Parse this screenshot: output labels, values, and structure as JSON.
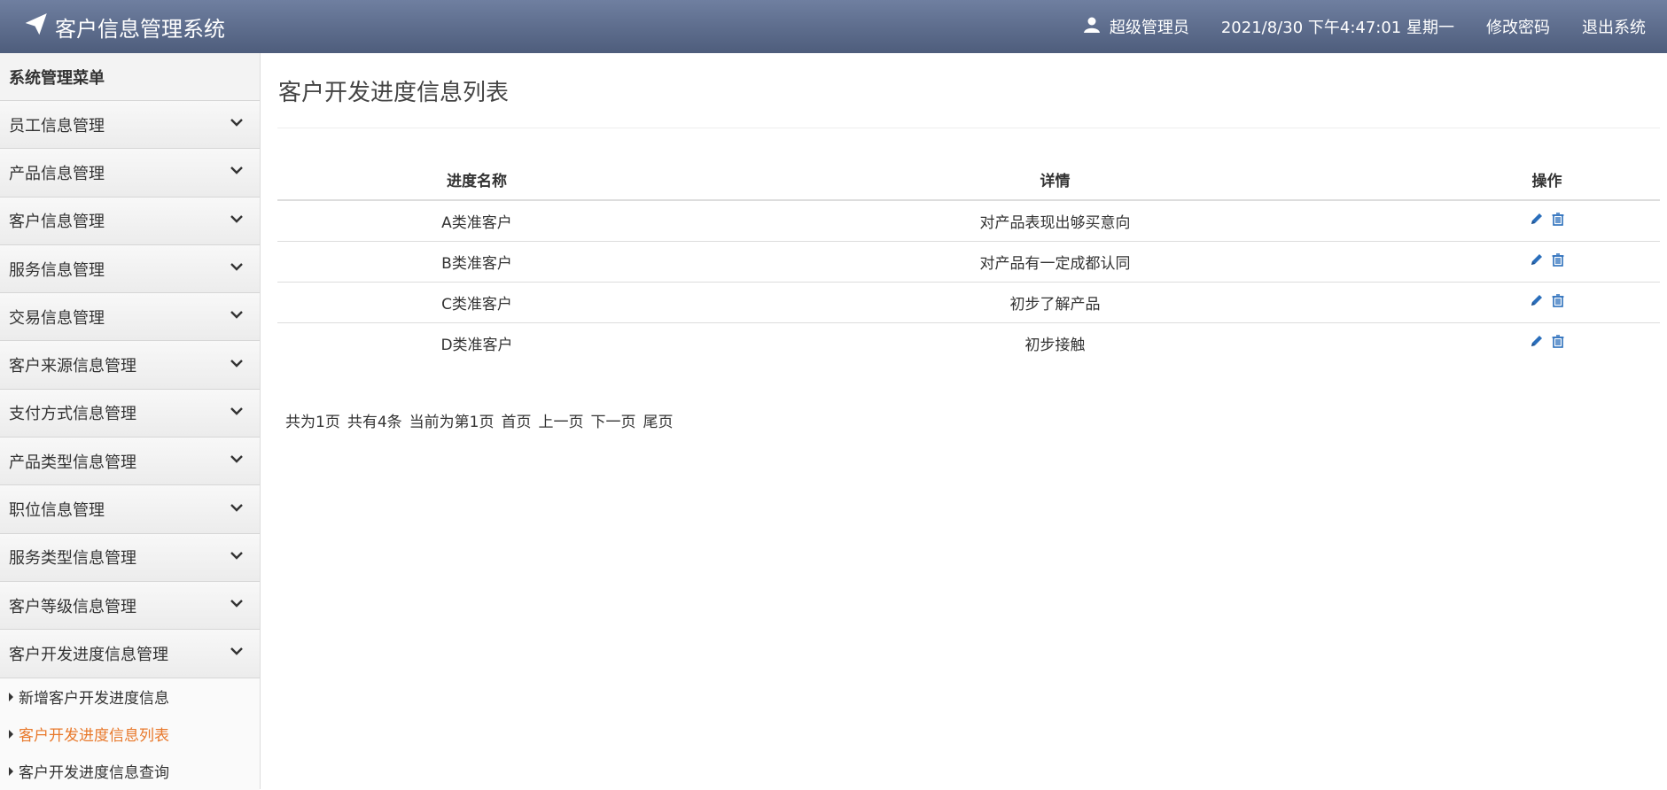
{
  "header": {
    "title": "客户信息管理系统",
    "user": "超级管理员",
    "datetime": "2021/8/30 下午4:47:01 星期一",
    "change_password": "修改密码",
    "logout": "退出系统"
  },
  "sidebar": {
    "header": "系统管理菜单",
    "items": [
      {
        "label": "员工信息管理"
      },
      {
        "label": "产品信息管理"
      },
      {
        "label": "客户信息管理"
      },
      {
        "label": "服务信息管理"
      },
      {
        "label": "交易信息管理"
      },
      {
        "label": "客户来源信息管理"
      },
      {
        "label": "支付方式信息管理"
      },
      {
        "label": "产品类型信息管理"
      },
      {
        "label": "职位信息管理"
      },
      {
        "label": "服务类型信息管理"
      },
      {
        "label": "客户等级信息管理"
      },
      {
        "label": "客户开发进度信息管理"
      }
    ],
    "submenu": [
      {
        "label": "新增客户开发进度信息"
      },
      {
        "label": "客户开发进度信息列表"
      },
      {
        "label": "客户开发进度信息查询"
      }
    ]
  },
  "main": {
    "title": "客户开发进度信息列表",
    "table": {
      "headers": [
        "进度名称",
        "详情",
        "操作"
      ],
      "rows": [
        {
          "name": "A类准客户",
          "detail": "对产品表现出够买意向"
        },
        {
          "name": "B类准客户",
          "detail": "对产品有一定成都认同"
        },
        {
          "name": "C类准客户",
          "detail": "初步了解产品"
        },
        {
          "name": "D类准客户",
          "detail": "初步接触"
        }
      ]
    },
    "pagination": {
      "total_pages": "共为1页",
      "total_count": "共有4条",
      "current": "当前为第1页",
      "first": "首页",
      "prev": "上一页",
      "next": "下一页",
      "last": "尾页"
    }
  },
  "colors": {
    "header_bg": "#5a6a8b",
    "active_link": "#e8782a",
    "icon_blue": "#2a6ebb"
  }
}
